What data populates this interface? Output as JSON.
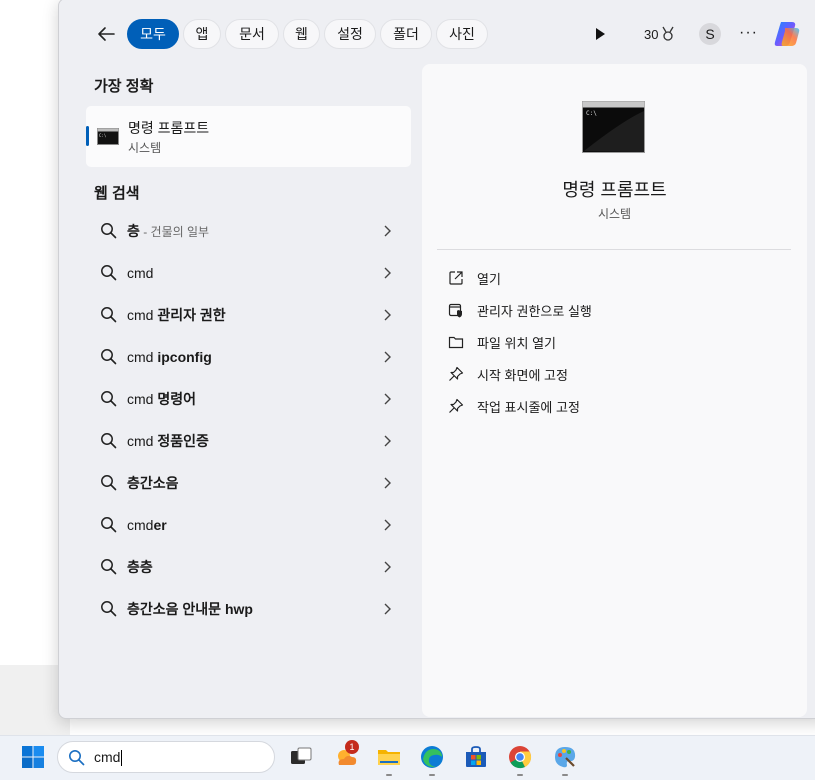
{
  "filter_tabs": [
    "모두",
    "앱",
    "문서",
    "웹",
    "설정",
    "폴더",
    "사진"
  ],
  "points": "30",
  "avatar_initial": "S",
  "more_label": "···",
  "best_match": {
    "heading": "가장 정확",
    "name": "명령 프롬프트",
    "category": "시스템"
  },
  "web_search": {
    "heading": "웹 검색",
    "items": [
      {
        "plain": "",
        "bold": "층",
        "note": " - 건물의 일부"
      },
      {
        "plain": "cmd",
        "bold": "",
        "note": ""
      },
      {
        "plain": "cmd ",
        "bold": "관리자 권한",
        "note": ""
      },
      {
        "plain": "cmd ",
        "bold": "ipconfig",
        "note": ""
      },
      {
        "plain": "cmd ",
        "bold": "명령어",
        "note": ""
      },
      {
        "plain": "cmd ",
        "bold": "정품인증",
        "note": ""
      },
      {
        "plain": "",
        "bold": "층간소음",
        "note": ""
      },
      {
        "plain": "cmd",
        "bold": "er",
        "note": ""
      },
      {
        "plain": "",
        "bold": "층층",
        "note": ""
      },
      {
        "plain": "",
        "bold": "층간소음 안내문 hwp",
        "note": ""
      }
    ]
  },
  "detail": {
    "title": "명령 프롬프트",
    "category": "시스템",
    "actions": [
      {
        "icon": "open-external-icon",
        "label": "열기"
      },
      {
        "icon": "shield-run-icon",
        "label": "관리자 권한으로 실행"
      },
      {
        "icon": "folder-icon",
        "label": "파일 위치 열기"
      },
      {
        "icon": "pin-icon",
        "label": "시작 화면에 고정"
      },
      {
        "icon": "pin-icon",
        "label": "작업 표시줄에 고정"
      }
    ]
  },
  "taskbar": {
    "search_query": "cmd",
    "notification_count": "1"
  },
  "colors": {
    "accent": "#005fb8",
    "panel_bg": "#eeeff3",
    "detail_bg": "#f9f9fa"
  }
}
